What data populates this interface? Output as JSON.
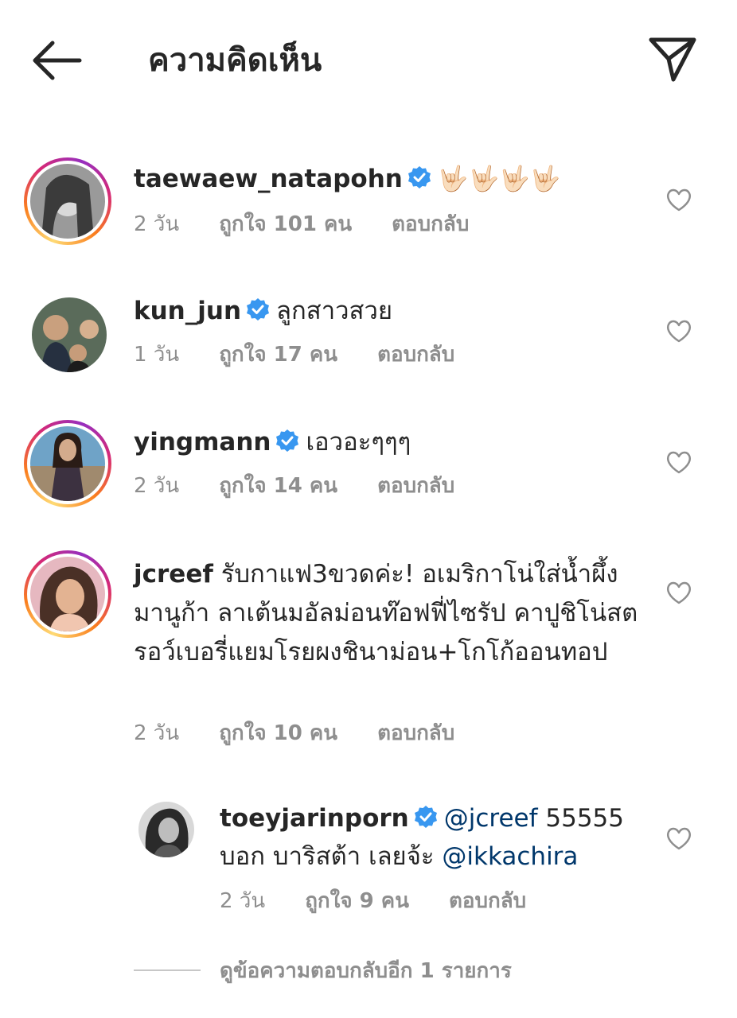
{
  "header": {
    "title": "ความคิดเห็น",
    "back_icon": "arrow-left-icon",
    "send_icon": "paper-plane-icon"
  },
  "colors": {
    "text": "#262626",
    "secondary": "#8e8e8e",
    "verified": "#3897f0",
    "mention": "#00376b"
  },
  "comments": [
    {
      "username": "taewaew_natapohn",
      "verified": true,
      "text": "🤟🏻🤟🏻🤟🏻🤟🏻",
      "time": "2 วัน",
      "likes": "ถูกใจ 101 คน",
      "reply": "ตอบกลับ"
    },
    {
      "username": "kun_jun",
      "verified": true,
      "text": "ลูกสาวสวย",
      "time": "1 วัน",
      "likes": "ถูกใจ 17 คน",
      "reply": "ตอบกลับ"
    },
    {
      "username": "yingmann",
      "verified": true,
      "text": "เอวอะๆๆๆ",
      "time": "2 วัน",
      "likes": "ถูกใจ 14 คน",
      "reply": "ตอบกลับ"
    },
    {
      "username": "jcreef",
      "verified": false,
      "text": "รับกาแฟ3ขวดค่ะ! อเมริกาโน่ใส่น้ำผึ้งมานูก้า ลาเต้นมอัลม่อนท๊อฟฟี่ไซรัป คาปูชิโน่สตรอว์เบอรี่แยมโรยผงชินาม่อน+โกโก้ออนทอป",
      "time": "2 วัน",
      "likes": "ถูกใจ 10 คน",
      "reply": "ตอบกลับ"
    }
  ],
  "reply_comment": {
    "username": "toeyjarinporn",
    "verified": true,
    "mention1": "@jcreef",
    "text1": " 55555",
    "text2": "บอก บาริสต้า เลยจ้ะ ",
    "mention2": "@ikkachira",
    "time": "2 วัน",
    "likes": "ถูกใจ 9 คน",
    "reply": "ตอบกลับ"
  },
  "view_more_replies": "ดูข้อความตอบกลับอีก 1 รายการ"
}
